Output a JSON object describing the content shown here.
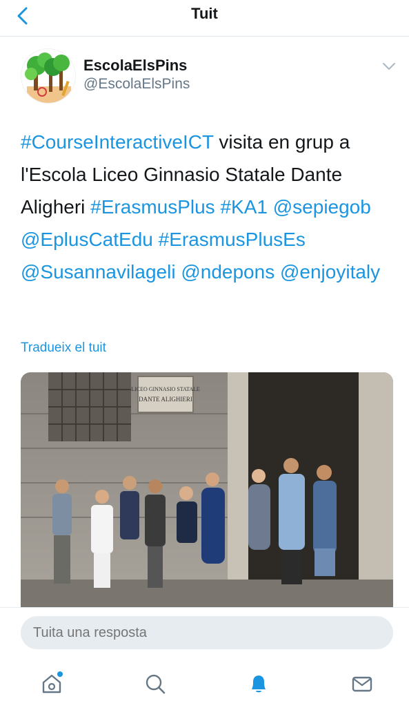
{
  "header": {
    "title": "Tuit",
    "back_icon": "chevron-left-icon"
  },
  "colors": {
    "accent": "#1b95e0",
    "text": "#14171a",
    "secondary": "#657786"
  },
  "tweet": {
    "author": {
      "display_name": "EscolaElsPins",
      "handle": "@EscolaElsPins"
    },
    "menu_icon": "chevron-down-icon",
    "text_parts": [
      {
        "text": "#CourseInteractiveICT",
        "type": "hashtag"
      },
      {
        "text": " visita en grup  a l'Escola Liceo Ginnasio Statale Dante Aligheri ",
        "type": "plain"
      },
      {
        "text": "#ErasmusPlus",
        "type": "hashtag"
      },
      {
        "text": " ",
        "type": "plain"
      },
      {
        "text": "#KA1",
        "type": "hashtag"
      },
      {
        "text": " ",
        "type": "plain"
      },
      {
        "text": "@sepiegob",
        "type": "mention"
      },
      {
        "text": " ",
        "type": "plain"
      },
      {
        "text": "@EplusCatEdu",
        "type": "mention"
      },
      {
        "text": " ",
        "type": "plain"
      },
      {
        "text": "#ErasmusPlusEs",
        "type": "hashtag"
      },
      {
        "text": " ",
        "type": "plain"
      },
      {
        "text": "@Susannavilageli",
        "type": "mention"
      },
      {
        "text": " ",
        "type": "plain"
      },
      {
        "text": "@ndepons",
        "type": "mention"
      },
      {
        "text": " ",
        "type": "plain"
      },
      {
        "text": "@enjoyitaly",
        "type": "mention"
      }
    ],
    "translate_label": "Tradueix el tuit",
    "photo": {
      "sign_line1": "LICEO GINNASIO STATALE",
      "sign_line2": "DANTE ALIGHIERI"
    }
  },
  "reply": {
    "placeholder": "Tuita una resposta"
  },
  "tabbar": {
    "items": [
      {
        "name": "home",
        "icon": "home-icon",
        "has_dot": true
      },
      {
        "name": "search",
        "icon": "search-icon",
        "active": false
      },
      {
        "name": "notifications",
        "icon": "bell-icon",
        "active": true
      },
      {
        "name": "messages",
        "icon": "mail-icon",
        "active": false
      }
    ]
  }
}
